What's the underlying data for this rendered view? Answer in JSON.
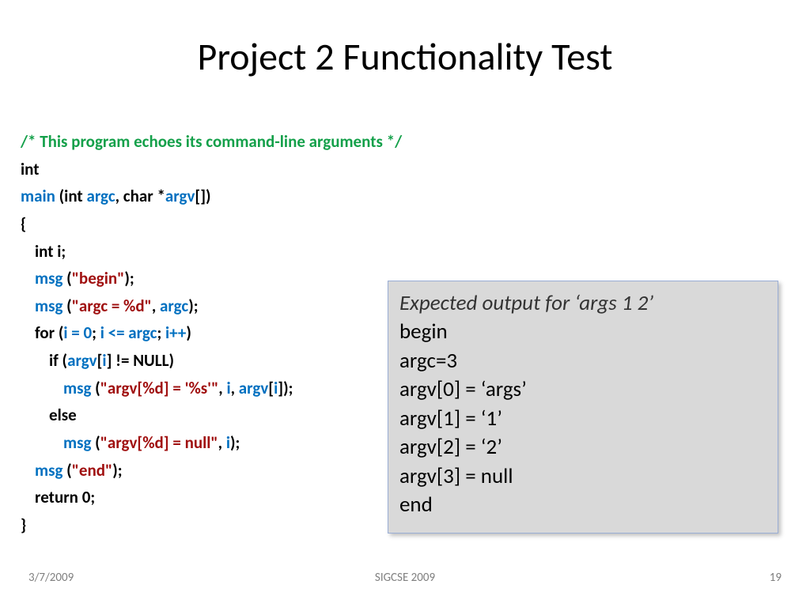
{
  "title": "Project 2 Functionality Test",
  "code": {
    "comment": "/* This program echoes its command-line arguments */",
    "int": "int",
    "main": "main",
    "sig_open": " (int ",
    "argc": "argc",
    "sig_mid": ", char *",
    "argv": "argv",
    "sig_close": "[])",
    "brace_open": "{",
    "int_i": "int i;",
    "msg": "msg",
    "begin_open": " (",
    "begin_str": "\"begin\"",
    "call_close": ");",
    "argc_str": "\"argc = %d\"",
    "comma_sp": ", ",
    "for": "for",
    "for_open": " (",
    "ieq0": "i = 0",
    "semi": "; ",
    "ile": "i <= ",
    "ipp": "i++",
    "paren_close": ")",
    "if": "if",
    "if_open": " (",
    "bracket_open": "[",
    "i": "i",
    "bracket_close": "]",
    "ne_null": " != NULL)",
    "argv_idx_str": "\"argv[%d] = '%s'\"",
    "else": "else",
    "argv_null_str": "\"argv[%d] = null\"",
    "end_str": "\"end\"",
    "return0": "return 0;",
    "brace_close": "}"
  },
  "output": {
    "title": "Expected output for ‘args 1 2’",
    "lines": [
      "begin",
      "argc=3",
      "argv[0] = ‘args’",
      "argv[1] = ‘1’",
      "argv[2] = ‘2’",
      "argv[3] = null",
      "end"
    ]
  },
  "footer": {
    "date": "3/7/2009",
    "venue": "SIGCSE 2009",
    "page": "19"
  }
}
